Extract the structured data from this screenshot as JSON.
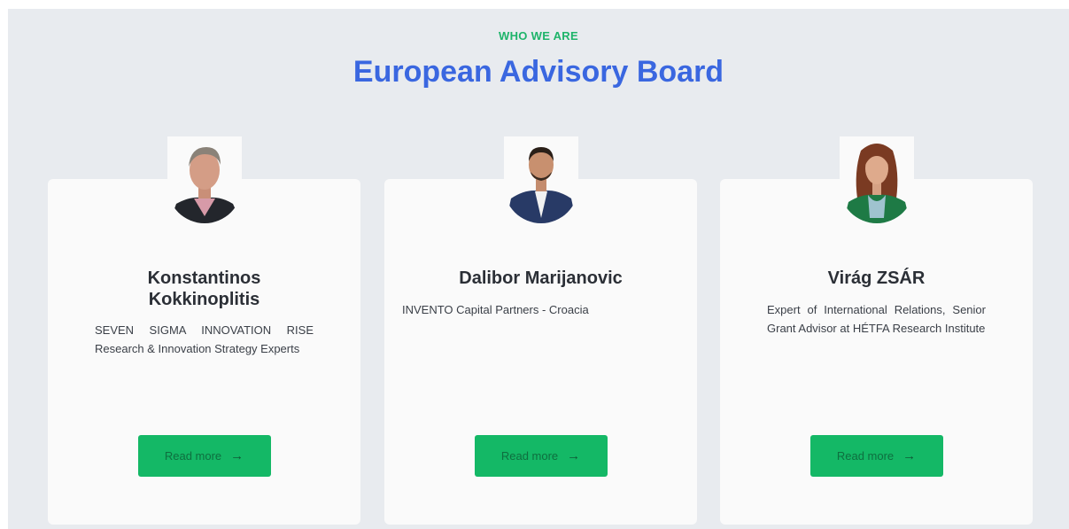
{
  "section": {
    "eyebrow": "WHO WE ARE",
    "title": "European Advisory Board"
  },
  "colors": {
    "background": "#e8ebef",
    "card": "#fafafa",
    "accent_green": "#14b866",
    "title_blue": "#3a67e0"
  },
  "members": [
    {
      "name": "Konstantinos Kokkinoplitis",
      "description": "SEVEN SIGMA INNOVATION RISE Research & Innovation Strategy Experts",
      "button_label": "Read more",
      "button_icon": "arrow-right-icon"
    },
    {
      "name": "Dalibor Marijanovic",
      "description": "INVENTO Capital Partners - Croacia",
      "button_label": "Read more",
      "button_icon": "arrow-right-icon"
    },
    {
      "name": "Virág ZSÁR",
      "description": "Expert of International Relations, Senior Grant Advisor at HÉTFA Research Institute",
      "button_label": "Read more",
      "button_icon": "arrow-right-icon"
    }
  ]
}
